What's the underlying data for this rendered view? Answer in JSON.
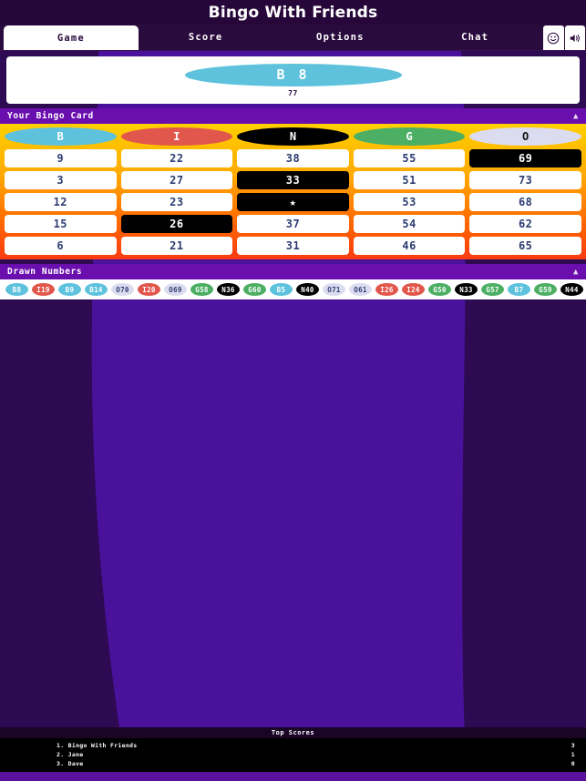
{
  "window": {
    "title": "Bingo With Friends"
  },
  "tabs": [
    {
      "label": "Game",
      "active": true
    },
    {
      "label": "Score",
      "active": false
    },
    {
      "label": "Options",
      "active": false
    },
    {
      "label": "Chat",
      "active": false
    }
  ],
  "tab_icons": [
    {
      "name": "emoji-icon",
      "glyph": "smiley"
    },
    {
      "name": "volume-icon",
      "glyph": "speaker"
    }
  ],
  "current_draw": {
    "letter": "B",
    "number": "8",
    "display": "B 8",
    "remaining": "77",
    "color": "#5ec2dd"
  },
  "bingo_card": {
    "header_label": "Your Bingo Card",
    "columns": [
      {
        "letter": "B",
        "color": "#5ec2dd",
        "text_color": "#ffffff"
      },
      {
        "letter": "I",
        "color": "#e2574c",
        "text_color": "#ffffff"
      },
      {
        "letter": "N",
        "color": "#000000",
        "text_color": "#ffffff"
      },
      {
        "letter": "G",
        "color": "#4caf63",
        "text_color": "#ffffff"
      },
      {
        "letter": "O",
        "color": "#dcdcf0",
        "text_color": "#111111"
      }
    ],
    "rows": [
      [
        {
          "value": "9",
          "marked": false,
          "free": false
        },
        {
          "value": "22",
          "marked": false,
          "free": false
        },
        {
          "value": "38",
          "marked": false,
          "free": false
        },
        {
          "value": "55",
          "marked": false,
          "free": false
        },
        {
          "value": "69",
          "marked": true,
          "free": false
        }
      ],
      [
        {
          "value": "3",
          "marked": false,
          "free": false
        },
        {
          "value": "27",
          "marked": false,
          "free": false
        },
        {
          "value": "33",
          "marked": true,
          "free": false
        },
        {
          "value": "51",
          "marked": false,
          "free": false
        },
        {
          "value": "73",
          "marked": false,
          "free": false
        }
      ],
      [
        {
          "value": "12",
          "marked": false,
          "free": false
        },
        {
          "value": "23",
          "marked": false,
          "free": false
        },
        {
          "value": "★",
          "marked": true,
          "free": true
        },
        {
          "value": "53",
          "marked": false,
          "free": false
        },
        {
          "value": "68",
          "marked": false,
          "free": false
        }
      ],
      [
        {
          "value": "15",
          "marked": false,
          "free": false
        },
        {
          "value": "26",
          "marked": true,
          "free": false
        },
        {
          "value": "37",
          "marked": false,
          "free": false
        },
        {
          "value": "54",
          "marked": false,
          "free": false
        },
        {
          "value": "62",
          "marked": false,
          "free": false
        }
      ],
      [
        {
          "value": "6",
          "marked": false,
          "free": false
        },
        {
          "value": "21",
          "marked": false,
          "free": false
        },
        {
          "value": "31",
          "marked": false,
          "free": false
        },
        {
          "value": "46",
          "marked": false,
          "free": false
        },
        {
          "value": "65",
          "marked": false,
          "free": false
        }
      ]
    ]
  },
  "drawn_numbers": {
    "header_label": "Drawn Numbers",
    "balls": [
      {
        "label": "B8",
        "color": "#5ec2dd",
        "text_color": "#ffffff"
      },
      {
        "label": "I19",
        "color": "#e2574c",
        "text_color": "#ffffff"
      },
      {
        "label": "B9",
        "color": "#5ec2dd",
        "text_color": "#ffffff"
      },
      {
        "label": "B14",
        "color": "#5ec2dd",
        "text_color": "#ffffff"
      },
      {
        "label": "O70",
        "color": "#dcdcf0",
        "text_color": "#2d3d72"
      },
      {
        "label": "I20",
        "color": "#e2574c",
        "text_color": "#ffffff"
      },
      {
        "label": "O69",
        "color": "#dcdcf0",
        "text_color": "#2d3d72"
      },
      {
        "label": "G58",
        "color": "#4caf63",
        "text_color": "#ffffff"
      },
      {
        "label": "N36",
        "color": "#000000",
        "text_color": "#ffffff"
      },
      {
        "label": "G60",
        "color": "#4caf63",
        "text_color": "#ffffff"
      },
      {
        "label": "B5",
        "color": "#5ec2dd",
        "text_color": "#ffffff"
      },
      {
        "label": "N40",
        "color": "#000000",
        "text_color": "#ffffff"
      },
      {
        "label": "O71",
        "color": "#dcdcf0",
        "text_color": "#2d3d72"
      },
      {
        "label": "O61",
        "color": "#dcdcf0",
        "text_color": "#2d3d72"
      },
      {
        "label": "I26",
        "color": "#e2574c",
        "text_color": "#ffffff"
      },
      {
        "label": "I24",
        "color": "#e2574c",
        "text_color": "#ffffff"
      },
      {
        "label": "G50",
        "color": "#4caf63",
        "text_color": "#ffffff"
      },
      {
        "label": "N33",
        "color": "#000000",
        "text_color": "#ffffff"
      },
      {
        "label": "G57",
        "color": "#4caf63",
        "text_color": "#ffffff"
      },
      {
        "label": "B7",
        "color": "#5ec2dd",
        "text_color": "#ffffff"
      },
      {
        "label": "G59",
        "color": "#4caf63",
        "text_color": "#ffffff"
      },
      {
        "label": "N44",
        "color": "#000000",
        "text_color": "#ffffff"
      }
    ]
  },
  "top_scores": {
    "title": "Top Scores",
    "entries": [
      {
        "rank": "1.",
        "name": "Bingo With Friends",
        "score": "3"
      },
      {
        "rank": "2.",
        "name": "Jane",
        "score": "1"
      },
      {
        "rank": "3.",
        "name": "Dave",
        "score": "0"
      }
    ]
  },
  "theme": {
    "title_bg": "#27073a",
    "tab_bg": "#2a0b3e",
    "section_bar": "#6a0ead",
    "backdrop_dark": "#2d0a52",
    "backdrop_light": "#4a119b"
  }
}
